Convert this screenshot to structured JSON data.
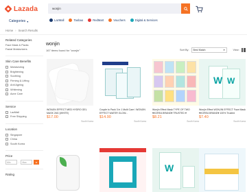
{
  "header": {
    "logo": "Lazada",
    "categories_label": "Categories",
    "search_value": "wonjin",
    "quicklinks": [
      {
        "label": "LazMall",
        "color": "#1a3a6e"
      },
      {
        "label": "Taobao",
        "color": "#f57224"
      },
      {
        "label": "RedMart",
        "color": "#e53935"
      },
      {
        "label": "Vouchers",
        "color": "#f57224"
      },
      {
        "label": "Digital & Services",
        "color": "#1aa7b8"
      }
    ]
  },
  "breadcrumb": [
    "Home",
    "Search Results"
  ],
  "sidebar": {
    "related_title": "Related Categories",
    "related": [
      "Face Mask & Packs",
      "Facial Moisturizers"
    ],
    "benefits_title": "Skin Care Benefits",
    "benefits": [
      "Moisturizing",
      "Brightening",
      "Soothing",
      "Firming & Lifting",
      "Anti Ageing",
      "Whitening",
      "Acne Care"
    ],
    "service_title": "Service",
    "service": [
      "LazMall",
      "Free Shipping"
    ],
    "location_title": "Location",
    "location": [
      "Singapore",
      "China",
      "South Korea"
    ],
    "price_title": "Price",
    "price_min_placeholder": "Min",
    "price_max_placeholder": "Max",
    "rating_title": "Rating"
  },
  "main": {
    "title": "wonjin",
    "result_count": "167 items found for \"wonjin\"",
    "sort_label": "Sort By:",
    "sort_value": "Best Match",
    "view_label": "View:"
  },
  "products": [
    {
      "name": "WONJIN EFFECT MED HYDRO GEL MASK 26G (WHITE)",
      "price": "$17.00",
      "meta_left": "",
      "meta_right": "South Korea"
    },
    {
      "name": "Couple to Pack 3 in 1 Multi Care / WONJIN EFFECT WATER GLOW...",
      "price": "$14.90",
      "meta_left": "",
      "meta_right": "South Korea"
    },
    {
      "name": "Wonjin Effect Mask TYPE OF TWO ♥KOREA BRAND♥ TRUSTED ♥",
      "price": "$8.21",
      "meta_left": "",
      "meta_right": "South Korea"
    },
    {
      "name": "Wonjin Effect WONJIN EFFECT Face Mask ♥KOREA BRAND♥ 100% Trusted",
      "price": "$7.40",
      "meta_left": "",
      "meta_right": "South Korea"
    }
  ]
}
